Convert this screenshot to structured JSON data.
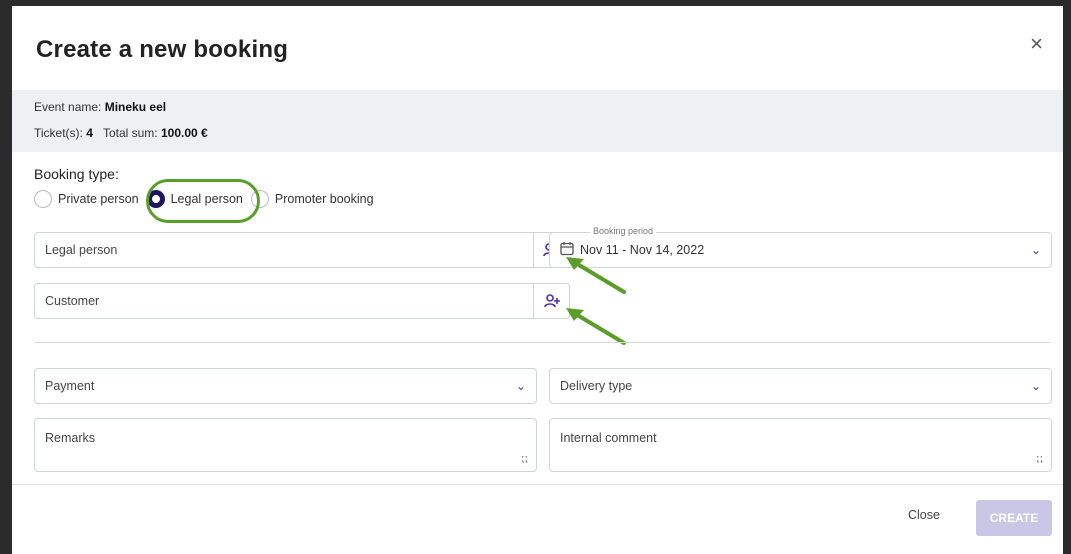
{
  "modal": {
    "title": "Create a new booking",
    "close_icon": "×"
  },
  "info": {
    "event_label": "Event name:",
    "event_name": "Mineku eel",
    "tickets_label": "Ticket(s):",
    "tickets": "4",
    "sum_label": "Total sum:",
    "sum": "100.00 €"
  },
  "booking_type": {
    "label": "Booking type:",
    "options": [
      {
        "label": "Private person",
        "selected": false
      },
      {
        "label": "Legal person",
        "selected": true
      },
      {
        "label": "Promoter booking",
        "selected": false
      }
    ]
  },
  "fields": {
    "legal_person_placeholder": "Legal person",
    "customer_placeholder": "Customer",
    "booking_period_label": "Booking period",
    "booking_period_start": "Nov 11",
    "booking_period_end": "- Nov 14, 2022",
    "payment_placeholder": "Payment",
    "delivery_placeholder": "Delivery type",
    "remarks_placeholder": "Remarks",
    "internal_comment_placeholder": "Internal comment"
  },
  "footer": {
    "close_label": "Close",
    "create_label": "CREATE"
  },
  "colors": {
    "accent": "#1e1660",
    "icon": "#4b2fb0",
    "highlight": "#5a9e2a",
    "create_disabled": "#c9c6e6"
  }
}
